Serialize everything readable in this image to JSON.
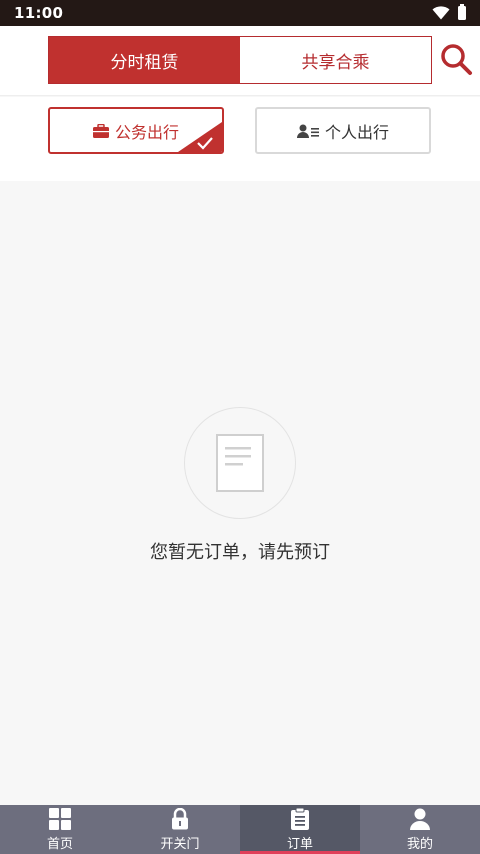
{
  "status_bar": {
    "time": "11:00"
  },
  "header": {
    "tabs": [
      {
        "label": "分时租赁",
        "active": true
      },
      {
        "label": "共享合乘",
        "active": false
      }
    ]
  },
  "trip_types": {
    "business": {
      "label": "公务出行",
      "selected": true
    },
    "personal": {
      "label": "个人出行",
      "selected": false
    }
  },
  "empty_state": {
    "message": "您暂无订单，请先预订"
  },
  "bottom_nav": {
    "items": [
      {
        "label": "首页",
        "icon": "grid-icon"
      },
      {
        "label": "开关门",
        "icon": "lock-icon"
      },
      {
        "label": "订单",
        "icon": "clipboard-icon",
        "active": true
      },
      {
        "label": "我的",
        "icon": "user-icon"
      }
    ]
  },
  "colors": {
    "brand_red": "#c0312f",
    "nav_bg": "#6d6e7e",
    "nav_active_bg": "#555866",
    "nav_indicator": "#e0405a"
  }
}
